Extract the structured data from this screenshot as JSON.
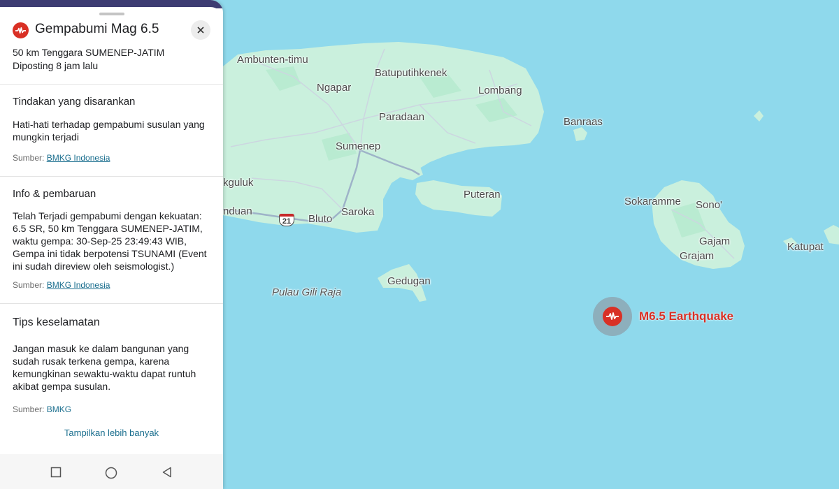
{
  "panel": {
    "title": "Gempabumi Mag 6.5",
    "location": "50 km Tenggara SUMENEP-JATIM",
    "posted": "Diposting 8 jam lalu",
    "sections": [
      {
        "heading": "Tindakan yang disarankan",
        "body": "Hati-hati terhadap gempabumi susulan yang mungkin terjadi",
        "source_prefix": "Sumber: ",
        "source_link": "BMKG Indonesia"
      },
      {
        "heading": "Info & pembaruan",
        "body": "Telah Terjadi gempabumi dengan kekuatan: 6.5 SR, 50 km Tenggara SUMENEP-JATIM, waktu gempa: 30-Sep-25 23:49:43 WIB, Gempa ini tidak berpotensi TSUNAMI (Event ini sudah direview oleh seismologist.)",
        "source_prefix": "Sumber: ",
        "source_link": "BMKG Indonesia"
      },
      {
        "heading": "Tips keselamatan",
        "body": "Jangan masuk ke dalam bangunan yang sudah rusak terkena gempa, karena kemungkinan sewaktu-waktu dapat runtuh akibat gempa susulan.",
        "source_prefix": "Sumber: ",
        "source_link": "BMKG"
      }
    ],
    "show_more": "Tampilkan lebih banyak",
    "close_icon": "close-icon",
    "alert_icon": "seismic-alert-icon"
  },
  "nav": {
    "icons": [
      "recents-square-icon",
      "home-circle-icon",
      "back-triangle-icon"
    ]
  },
  "map": {
    "places": {
      "ambunten_timu": "Ambunten-timu",
      "batuputihkenek": "Batuputihkenek",
      "ngapar": "Ngapar",
      "lombang": "Lombang",
      "paradaan": "Paradaan",
      "banraas": "Banraas",
      "sumenep": "Sumenep",
      "kguluk": "kguluk",
      "puteran": "Puteran",
      "nduan": "nduan",
      "bluto": "Bluto",
      "saroka": "Saroka",
      "sokaramme": "Sokaramme",
      "sono": "Sono'",
      "gajam": "Gajam",
      "grajam": "Grajam",
      "katupat": "Katupat",
      "gedugan": "Gedugan",
      "pulau_gili_raja": "Pulau Gili Raja"
    },
    "road_shield": "21",
    "earthquake_label": "M6.5 Earthquake",
    "colors": {
      "water": "#8fd9ec",
      "land": "#caf0dd",
      "land_dark": "#a8e6c6",
      "quake_red": "#d93025"
    }
  }
}
